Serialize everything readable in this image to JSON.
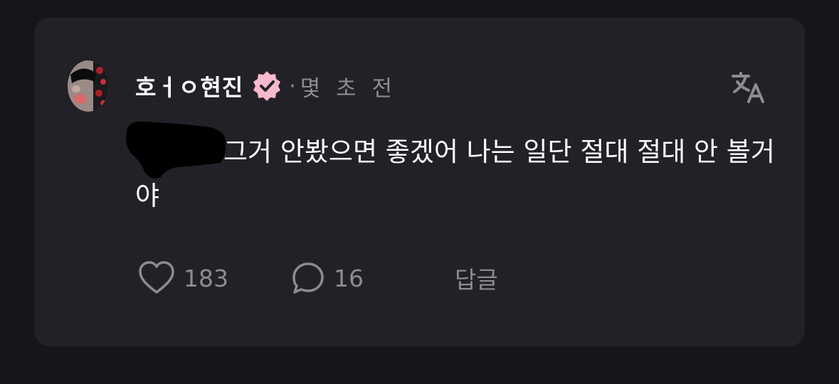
{
  "post": {
    "username": "호ㅓㅇ현진",
    "timestamp": "몇 초 전",
    "separator": "·",
    "text": "그거 안봤으면 좋겠어 나는 일단 절대 절대 안 볼거야",
    "verified_badge_icon": "verified-badge-icon",
    "translate_icon": "translate-icon",
    "badge_color": "#f7b9cc"
  },
  "actions": {
    "like_count": "183",
    "comment_count": "16",
    "reply_label": "답글"
  }
}
